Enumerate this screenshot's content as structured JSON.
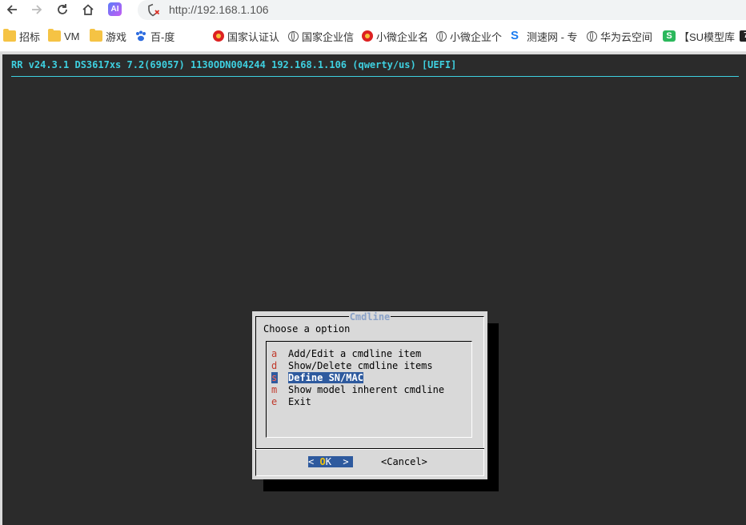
{
  "browser": {
    "url": "http://192.168.1.106",
    "ai_label": "AI"
  },
  "bookmarks": [
    {
      "label": "招标",
      "icon": "folder-icon"
    },
    {
      "label": "VM",
      "icon": "folder-icon"
    },
    {
      "label": "游戏",
      "icon": "folder-icon"
    },
    {
      "label": "百-度",
      "icon": "paw-icon"
    },
    {
      "label": "国家认证认",
      "icon": "emblem-icon"
    },
    {
      "label": "国家企业信",
      "icon": "globe-icon"
    },
    {
      "label": "小微企业名",
      "icon": "emblem-icon"
    },
    {
      "label": "小微企业个",
      "icon": "globe-icon"
    },
    {
      "label": "测速网 - 专",
      "icon": "speedtest-icon"
    },
    {
      "label": "华为云空间",
      "icon": "globe-icon"
    },
    {
      "label": "【SU模型库",
      "icon": "su-icon"
    }
  ],
  "terminal": {
    "title": "RR v24.3.1 DS3617xs 7.2(69057) 1130ODN004244 192.168.1.106 (qwerty/us) [UEFI]"
  },
  "dialog": {
    "title": "Cmdline",
    "prompt": "Choose a option",
    "items": [
      {
        "key": "a",
        "label": "Add/Edit a cmdline item"
      },
      {
        "key": "d",
        "label": "Show/Delete cmdline items"
      },
      {
        "key": "s",
        "label": "Define SN/MAC"
      },
      {
        "key": "m",
        "label": "Show model inherent cmdline"
      },
      {
        "key": "e",
        "label": "Exit"
      }
    ],
    "selected_index": 2,
    "ok_left": "< ",
    "ok_hotkey": "O",
    "ok_rest": "K  >",
    "cancel_label": "<Cancel>"
  },
  "colors": {
    "terminal_bg": "#2b2b2b",
    "title_cyan": "#3ed0e0",
    "selection_blue": "#2e5a9e",
    "hotkey_red": "#c0392b"
  }
}
